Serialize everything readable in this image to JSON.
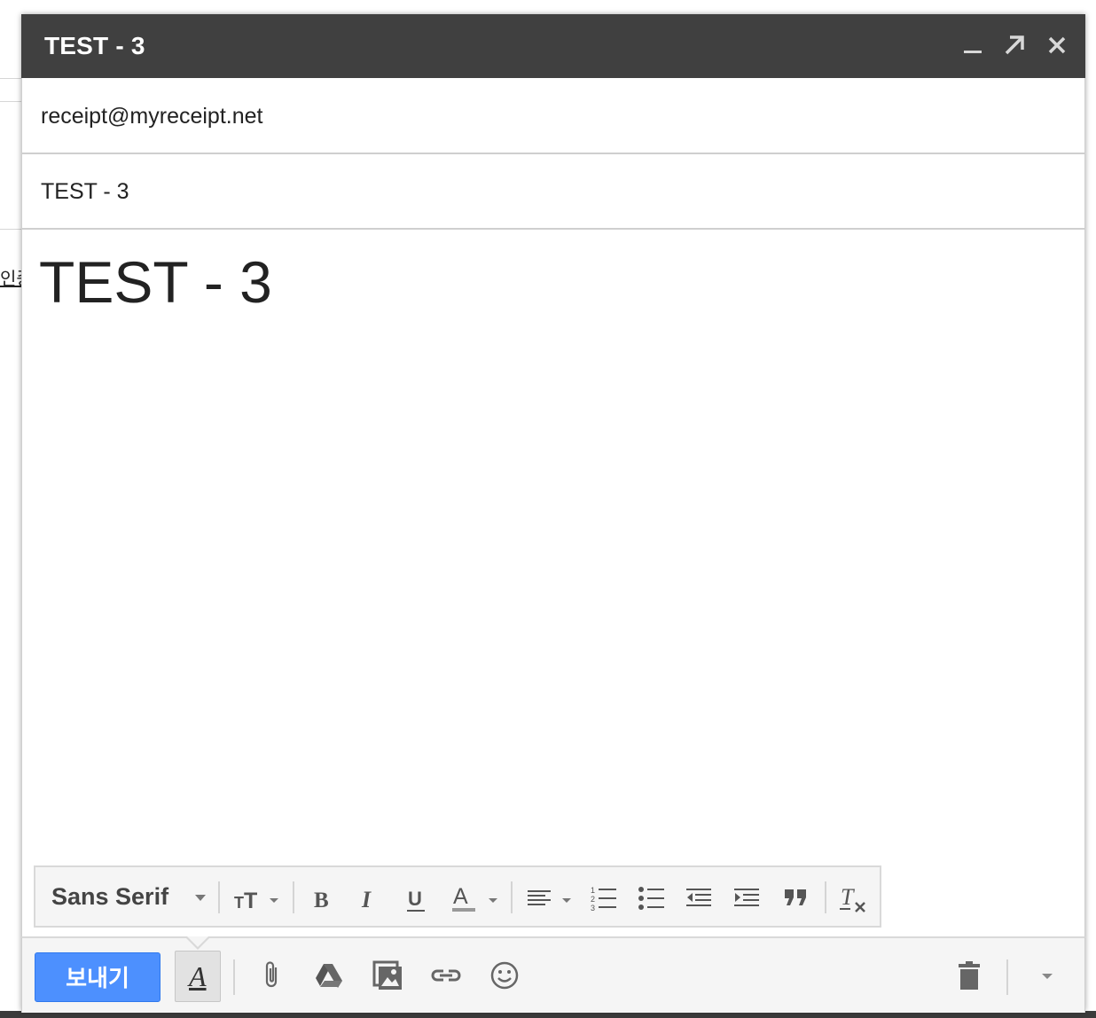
{
  "background": {
    "fragment_text": "인증"
  },
  "compose": {
    "title": "TEST - 3",
    "window_controls": {
      "minimize_icon": "minimize-icon",
      "popout_icon": "popout-arrow-icon",
      "close_icon": "close-icon"
    },
    "to_value": "receipt@myreceipt.net",
    "subject_value": "TEST - 3",
    "body_text": "TEST - 3"
  },
  "format_toolbar": {
    "font_family": "Sans Serif",
    "buttons": [
      "text-size-icon",
      "bold-icon",
      "italic-icon",
      "underline-icon",
      "text-color-icon",
      "align-icon",
      "numbered-list-icon",
      "bulleted-list-icon",
      "indent-less-icon",
      "indent-more-icon",
      "quote-icon",
      "remove-formatting-icon"
    ]
  },
  "bottom_toolbar": {
    "send_label": "보내기",
    "formatting_toggle_glyph": "A",
    "icons": [
      "attach-icon",
      "drive-icon",
      "insert-photo-icon",
      "insert-link-icon",
      "emoji-icon",
      "trash-icon",
      "more-options-icon"
    ],
    "colors": {
      "send_button": "#4d90fe",
      "title_bar": "#404040"
    }
  }
}
